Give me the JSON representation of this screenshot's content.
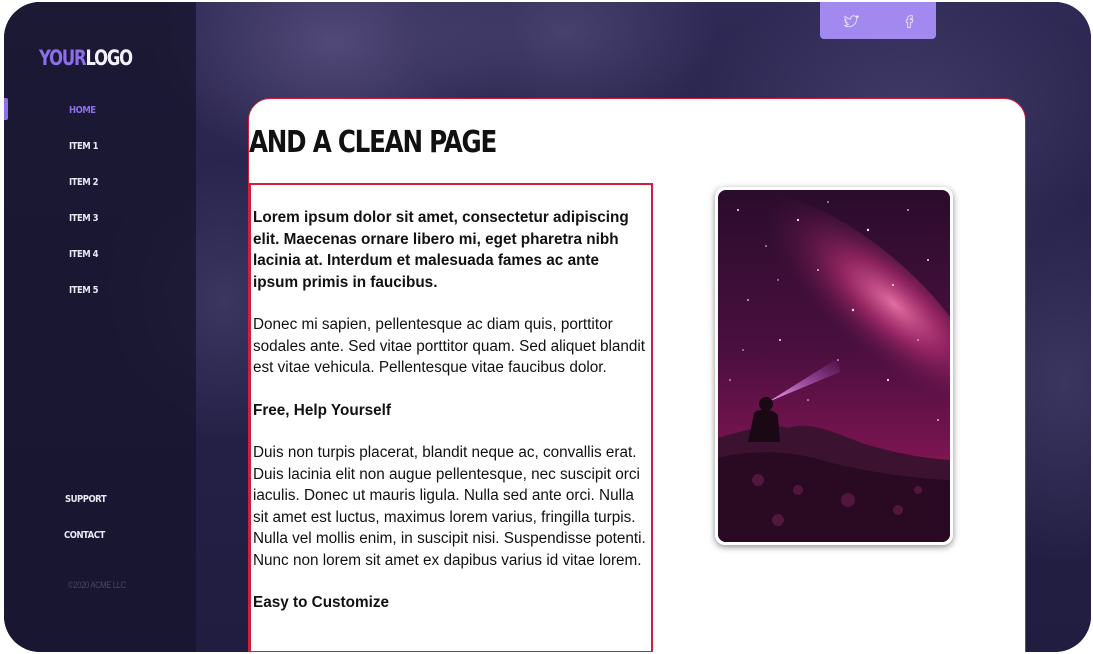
{
  "logo": {
    "part1": "YOUR",
    "part2": "LOGO"
  },
  "nav": {
    "items": [
      {
        "label": "HOME",
        "active": true
      },
      {
        "label": "ITEM 1"
      },
      {
        "label": "ITEM 2"
      },
      {
        "label": "ITEM 3"
      },
      {
        "label": "ITEM 4"
      },
      {
        "label": "ITEM 5"
      }
    ],
    "secondary": [
      {
        "label": "SUPPORT"
      },
      {
        "label": "CONTACT"
      }
    ],
    "copyright": "©2020 ACME LLC"
  },
  "social": {
    "icons": [
      "twitter-icon",
      "facebook-icon"
    ]
  },
  "page": {
    "title": "AND A CLEAN PAGE",
    "lead": "Lorem ipsum dolor sit amet, consectetur adipiscing elit. Maecenas ornare libero mi, eget pharetra nibh lacinia at. Interdum et malesuada fames ac ante ipsum primis in faucibus.",
    "paragraph1": "Donec mi sapien, pellentesque ac diam quis, porttitor sodales ante. Sed vitae porttitor quam. Sed aliquet blandit est vitae vehicula. Pellentesque vitae faucibus dolor.",
    "subheading1": "Free, Help Yourself",
    "paragraph2": "Duis non turpis placerat, blandit neque ac, convallis erat. Duis lacinia elit non augue pellentesque, nec suscipit orci iaculis. Donec ut mauris ligula. Nulla sed ante orci. Nulla sit amet est luctus, maximus lorem varius, fringilla turpis. Nulla vel mollis enim, in suscipit nisi. Suspendisse potenti. Nunc non lorem sit amet ex dapibus varius id vitae lorem.",
    "subheading2": "Easy to Customize"
  },
  "colors": {
    "accent": "#8d6ee6",
    "social_bar": "#a189f0",
    "highlight_border": "#d11f3b",
    "sidebar": "#16142c"
  }
}
